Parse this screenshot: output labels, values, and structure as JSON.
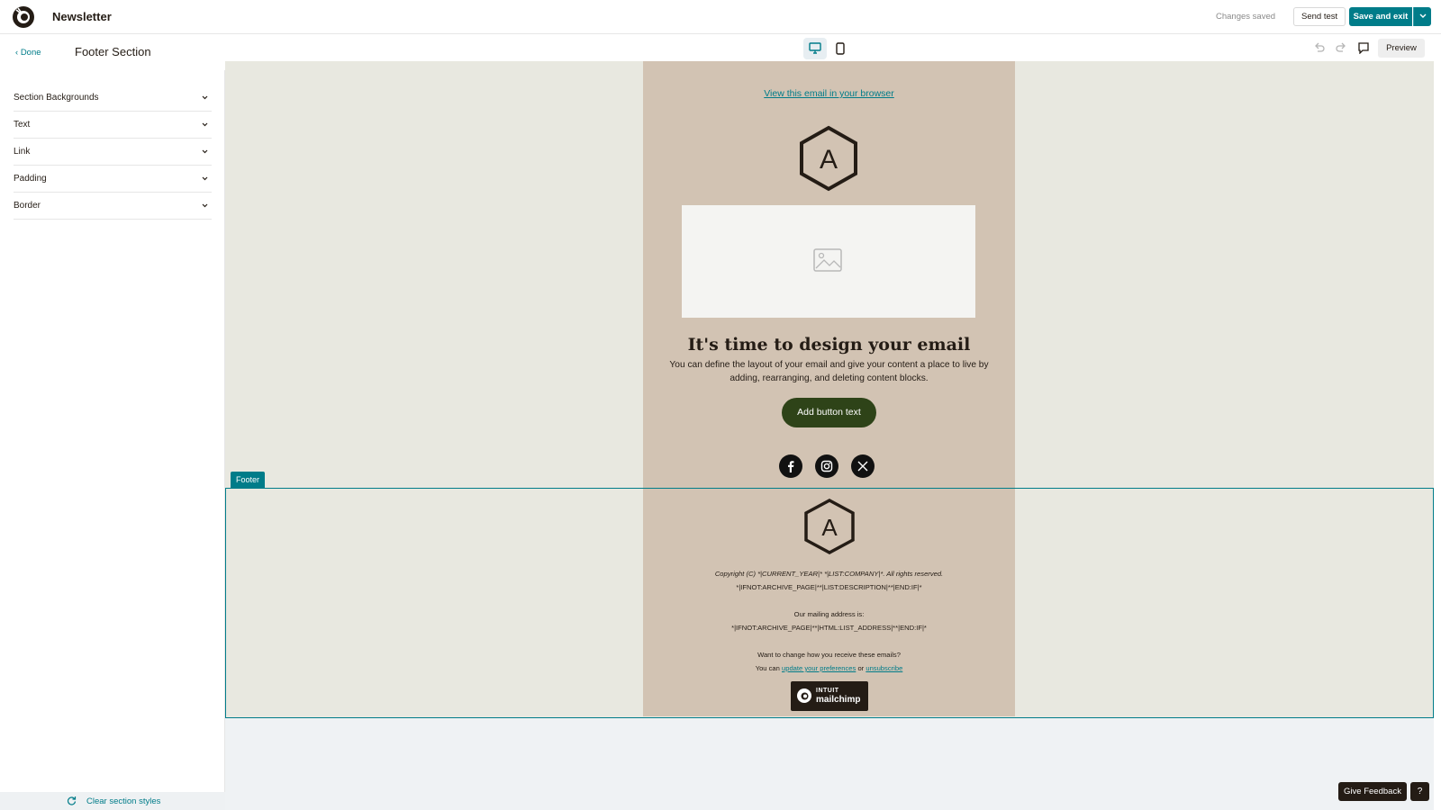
{
  "header": {
    "app_title": "Newsletter",
    "status": "Changes saved",
    "send_test": "Send test",
    "save_exit": "Save and exit"
  },
  "editbar": {
    "done": "Done",
    "section_title": "Footer Section",
    "preview": "Preview"
  },
  "sidebar": {
    "items": [
      {
        "label": "Section Backgrounds"
      },
      {
        "label": "Text"
      },
      {
        "label": "Link"
      },
      {
        "label": "Padding"
      },
      {
        "label": "Border"
      }
    ],
    "clear_styles": "Clear section styles"
  },
  "email": {
    "view_browser": "View this email in your browser",
    "logo_letter": "A",
    "headline": "It's time to design your email",
    "body": "You can define the layout of your email and give your content a place to live by adding, rearranging, and deleting content blocks.",
    "button": "Add button text",
    "social": [
      "facebook-icon",
      "instagram-icon",
      "x-icon"
    ]
  },
  "footer": {
    "tag": "Footer",
    "logo_letter": "A",
    "copyright": "Copyright (C) *|CURRENT_YEAR|* *|LIST:COMPANY|*. All rights reserved.",
    "description": "*|IFNOT:ARCHIVE_PAGE|**|LIST:DESCRIPTION|**|END:IF|*",
    "mailing_label": "Our mailing address is:",
    "address": "*|IFNOT:ARCHIVE_PAGE|**|HTML:LIST_ADDRESS|**|END:IF|*",
    "change_q": "Want to change how you receive these emails?",
    "you_can": "You can",
    "update_prefs": "update your preferences",
    "or": "or",
    "unsubscribe": "unsubscribe",
    "badge_intuit": "INTUIT",
    "badge_name": "mailchimp"
  },
  "bottom": {
    "feedback": "Give Feedback",
    "help": "?"
  },
  "colors": {
    "accent": "#007c89",
    "email_bg": "#d2c3b3",
    "canvas_bg": "#e8e8e0",
    "button": "#2e4318"
  }
}
